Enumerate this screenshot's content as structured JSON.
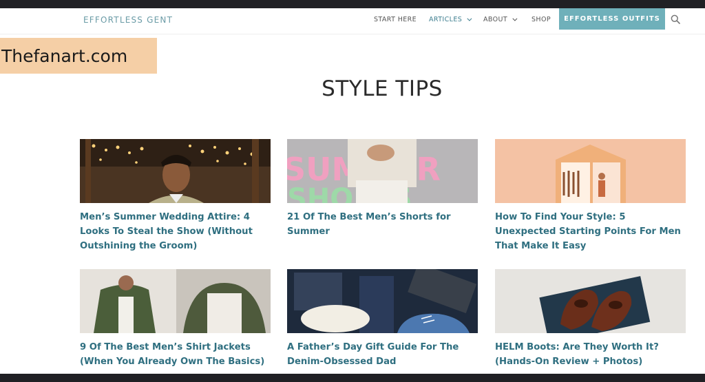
{
  "header": {
    "brand": "EFFORTLESS GENT",
    "menu": [
      {
        "label": "START HERE",
        "dropdown": false,
        "active": false
      },
      {
        "label": "ARTICLES",
        "dropdown": true,
        "active": true
      },
      {
        "label": "ABOUT",
        "dropdown": true,
        "active": false
      },
      {
        "label": "SHOP",
        "dropdown": false,
        "active": false
      }
    ],
    "cta_label": "EFFORTLESS OUTFITS",
    "search_icon": "search-icon"
  },
  "watermark": "Thefanart.com",
  "page_title": "STYLE TIPS",
  "colors": {
    "accent": "#6fb0ba",
    "link": "#2f6f80",
    "nav_active": "#3f7f90"
  },
  "articles": [
    {
      "title": "Men’s Summer Wedding Attire: 4 Looks To Steal the Show (Without Outshining the Groom)"
    },
    {
      "title": "21 Of The Best Men’s Shorts for Summer"
    },
    {
      "title": "How To Find Your Style: 5 Unexpected Starting Points For Men That Make It Easy"
    },
    {
      "title": "9 Of The Best Men’s Shirt Jackets (When You Already Own The Basics)"
    },
    {
      "title": "A Father’s Day Gift Guide For The Denim-Obsessed Dad"
    },
    {
      "title": "HELM Boots: Are They Worth It? (Hands-On Review + Photos)"
    }
  ]
}
